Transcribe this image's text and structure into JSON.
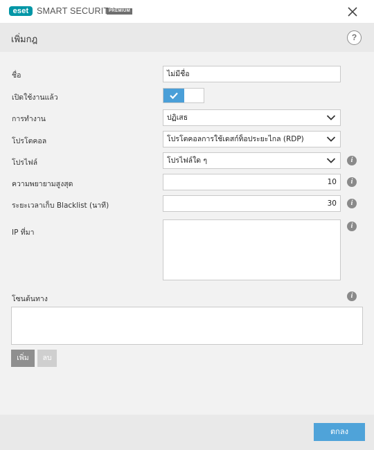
{
  "app": {
    "logo": "eset",
    "product": "SMART SECURITY",
    "edition": "PREMIUM"
  },
  "dialog": {
    "title": "เพิ่มกฎ"
  },
  "form": {
    "name": {
      "label": "ชื่อ",
      "value": "ไม่มีชื่อ"
    },
    "enabled": {
      "label": "เปิดใช้งานแล้ว",
      "checked": true
    },
    "action": {
      "label": "การทำงาน",
      "value": "ปฏิเสธ"
    },
    "protocol": {
      "label": "โปรโตคอล",
      "value": "โปรโตคอลการใช้เดสก์ท็อประยะไกล (RDP)"
    },
    "profile": {
      "label": "โปรไฟล์",
      "value": "โปรไฟล์ใด ๆ"
    },
    "max_attempts": {
      "label": "ความพยายามสูงสุด",
      "value": "10"
    },
    "blacklist_retention": {
      "label": "ระยะเวลาเก็บ Blacklist (นาที)",
      "value": "30"
    },
    "source_ip": {
      "label": "IP ที่มา",
      "value": ""
    },
    "source_zones": {
      "label": "โซนต้นทาง",
      "value": ""
    }
  },
  "buttons": {
    "add": "เพิ่ม",
    "remove": "ลบ",
    "ok": "ตกลง"
  },
  "icons": {
    "info": "info-icon",
    "help": "?"
  },
  "colors": {
    "accent": "#4fa3d9",
    "toggle_on": "#4a9fd8",
    "brand": "#0096a6"
  }
}
